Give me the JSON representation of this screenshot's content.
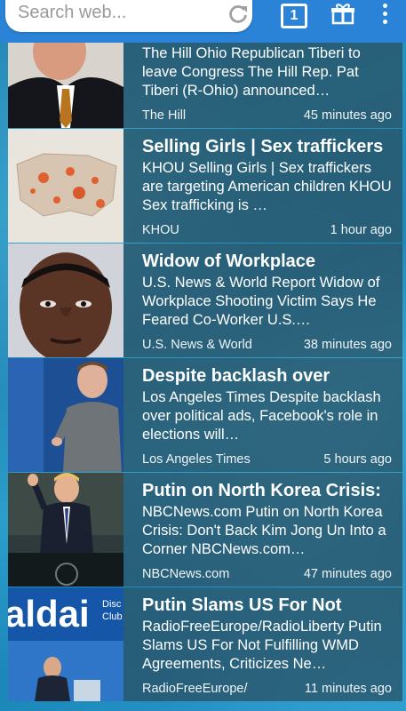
{
  "toolbar": {
    "search_placeholder": "Search web...",
    "tab_count": "1"
  },
  "articles": [
    {
      "title": "",
      "snippet": "The Hill Ohio Republican Tiberi to leave Congress The Hill Rep. Pat Tiberi (R-Ohio) announced…",
      "source": "The Hill",
      "time": "45 minutes ago"
    },
    {
      "title": "Selling Girls | Sex traffickers",
      "snippet": "KHOU Selling Girls | Sex traffickers are targeting American children KHOU Sex trafficking is …",
      "source": "KHOU",
      "time": "1 hour ago"
    },
    {
      "title": "Widow of Workplace",
      "snippet": "U.S. News & World Report Widow of Workplace Shooting Victim Says He Feared Co-Worker U.S.…",
      "source": "U.S. News & World",
      "time": "38 minutes ago"
    },
    {
      "title": "Despite backlash over",
      "snippet": "Los Angeles Times Despite backlash over political ads, Facebook's role in elections will…",
      "source": "Los Angeles Times",
      "time": "5 hours ago"
    },
    {
      "title": "Putin on North Korea Crisis:",
      "snippet": "NBCNews.com Putin on North Korea Crisis: Don't Back Kim Jong Un Into a Corner NBCNews.com…",
      "source": "NBCNews.com",
      "time": "47 minutes ago"
    },
    {
      "title": "Putin Slams US For Not",
      "snippet": "RadioFreeEurope/RadioLiberty Putin Slams US For Not Fulfilling WMD Agreements, Criticizes Ne…",
      "source": "RadioFreeEurope/",
      "time": "11 minutes ago"
    }
  ],
  "thumb_text": {
    "valdai": "aldai",
    "disc": "Disc",
    "club": "Club"
  },
  "colors": {
    "toolbar": "#2a83d6",
    "card_overlay": "#2a4e60"
  }
}
